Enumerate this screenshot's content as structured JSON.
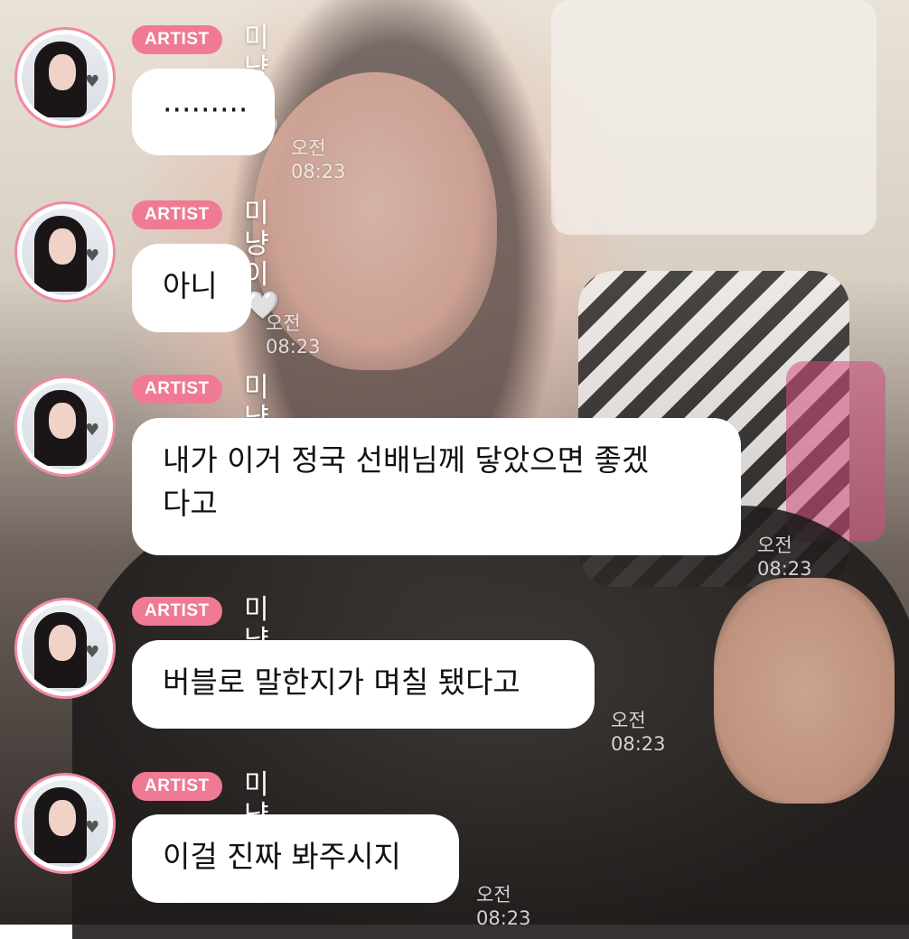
{
  "messages": [
    {
      "badge": "ARTIST",
      "name": "미냥이",
      "heart": "🤍",
      "text": "·········",
      "time": "오전 08:23"
    },
    {
      "badge": "ARTIST",
      "name": "미냥이",
      "heart": "🤍",
      "text": "아니",
      "time": "오전 08:23"
    },
    {
      "badge": "ARTIST",
      "name": "미냥이",
      "heart": "🤍",
      "text_line1": "내가 이거 정국 선배님께 닿았으면 좋겠",
      "text_line2": "다고",
      "time": "오전 08:23"
    },
    {
      "badge": "ARTIST",
      "name": "미냥이",
      "heart": "🤍",
      "text": "버블로 말한지가 며칠 됐다고",
      "time": "오전 08:23"
    },
    {
      "badge": "ARTIST",
      "name": "미냥이",
      "heart": "🤍",
      "text": "이걸 진짜 봐주시지",
      "time": "오전 08:23"
    }
  ],
  "colors": {
    "badge": "#f07a93",
    "avatar_ring": "#f08aa2",
    "bubble": "#ffffff"
  },
  "icons": {
    "heart": "white-heart-icon"
  }
}
